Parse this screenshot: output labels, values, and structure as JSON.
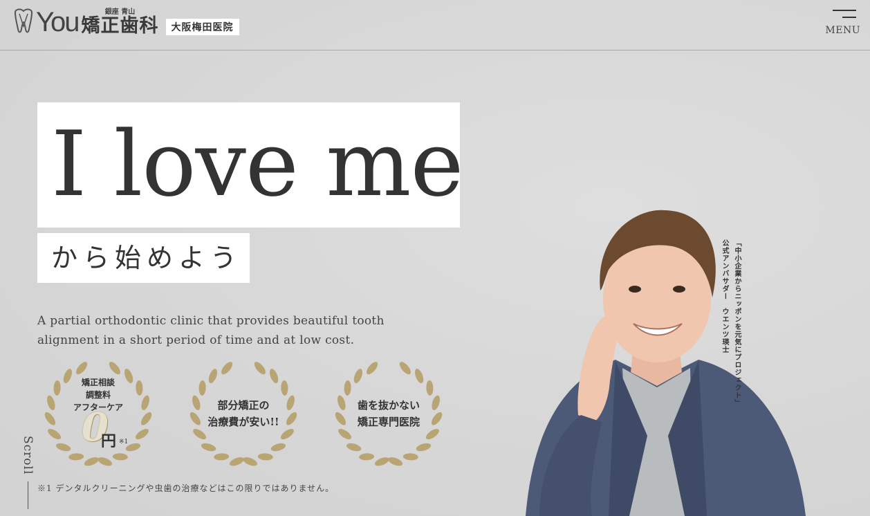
{
  "header": {
    "logo_you": "You",
    "logo_small": "銀座 青山",
    "logo_main": "矯正歯科",
    "branch": "大阪梅田医院",
    "menu_label": "MENU"
  },
  "hero": {
    "headline": "I love me",
    "subheadline": "から始めよう",
    "description": "A partial orthodontic clinic that provides beautiful tooth alignment in a short period of time and at low cost."
  },
  "awards": [
    {
      "lines": [
        "矯正相談",
        "調整料",
        "アフターケア"
      ],
      "zero": "0",
      "yen": "円",
      "note": "※1"
    },
    {
      "lines": [
        "部分矯正の",
        "治療費が安い!!"
      ]
    },
    {
      "lines": [
        "歯を抜かない",
        "矯正専門医院"
      ]
    }
  ],
  "scroll_label": "Scroll",
  "footnote": "※1 デンタルクリーニングや虫歯の治療などはこの限りではありません。",
  "ambassador": {
    "project": "「中小企業からニッポンを元気にプロジェクト」",
    "title": "公式アンバサダー　ウエンツ瑛士"
  },
  "colors": {
    "gold": "#b9a574",
    "background": "#d9d9d9",
    "text": "#333333"
  }
}
